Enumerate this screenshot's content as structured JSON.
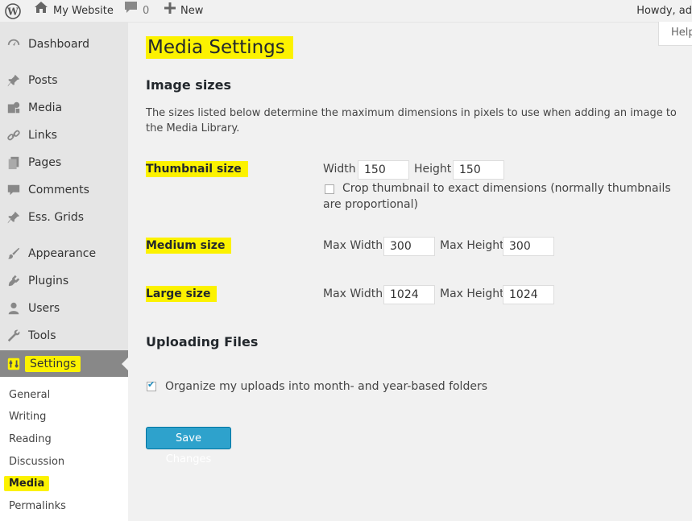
{
  "adminbar": {
    "site_name": "My Website",
    "comments_count": "0",
    "new_label": "New",
    "howdy": "Howdy, ad"
  },
  "help_tab": "Help",
  "sidebar": {
    "items": [
      {
        "label": "Dashboard",
        "icon": "dashboard-icon"
      },
      {
        "label": "Posts",
        "icon": "pin-icon"
      },
      {
        "label": "Media",
        "icon": "media-icon"
      },
      {
        "label": "Links",
        "icon": "link-icon"
      },
      {
        "label": "Pages",
        "icon": "pages-icon"
      },
      {
        "label": "Comments",
        "icon": "comment-icon"
      },
      {
        "label": "Ess. Grids",
        "icon": "pin-icon"
      },
      {
        "label": "Appearance",
        "icon": "brush-icon"
      },
      {
        "label": "Plugins",
        "icon": "plug-icon"
      },
      {
        "label": "Users",
        "icon": "user-icon"
      },
      {
        "label": "Tools",
        "icon": "wrench-icon"
      },
      {
        "label": "Settings",
        "icon": "settings-icon"
      }
    ],
    "submenu": [
      "General",
      "Writing",
      "Reading",
      "Discussion",
      "Media",
      "Permalinks"
    ]
  },
  "main": {
    "title": "Media Settings",
    "image_sizes_title": "Image sizes",
    "description": "The sizes listed below determine the maximum dimensions in pixels to use when adding an image to the Media Library.",
    "thumbnail": {
      "label": "Thumbnail size",
      "width_label": "Width",
      "width": "150",
      "height_label": "Height",
      "height": "150",
      "crop_label": "Crop thumbnail to exact dimensions (normally thumbnails are proportional)"
    },
    "medium": {
      "label": "Medium size",
      "max_width_label": "Max Width",
      "max_width": "300",
      "max_height_label": "Max Height",
      "max_height": "300"
    },
    "large": {
      "label": "Large size",
      "max_width_label": "Max Width",
      "max_width": "1024",
      "max_height_label": "Max Height",
      "max_height": "1024"
    },
    "uploading_title": "Uploading Files",
    "organize_label": "Organize my uploads into month- and year-based folders",
    "save_label": "Save Changes"
  },
  "colors": {
    "highlight": "#fcf200",
    "button": "#2ea2cc",
    "sidebar_current": "#888888"
  }
}
